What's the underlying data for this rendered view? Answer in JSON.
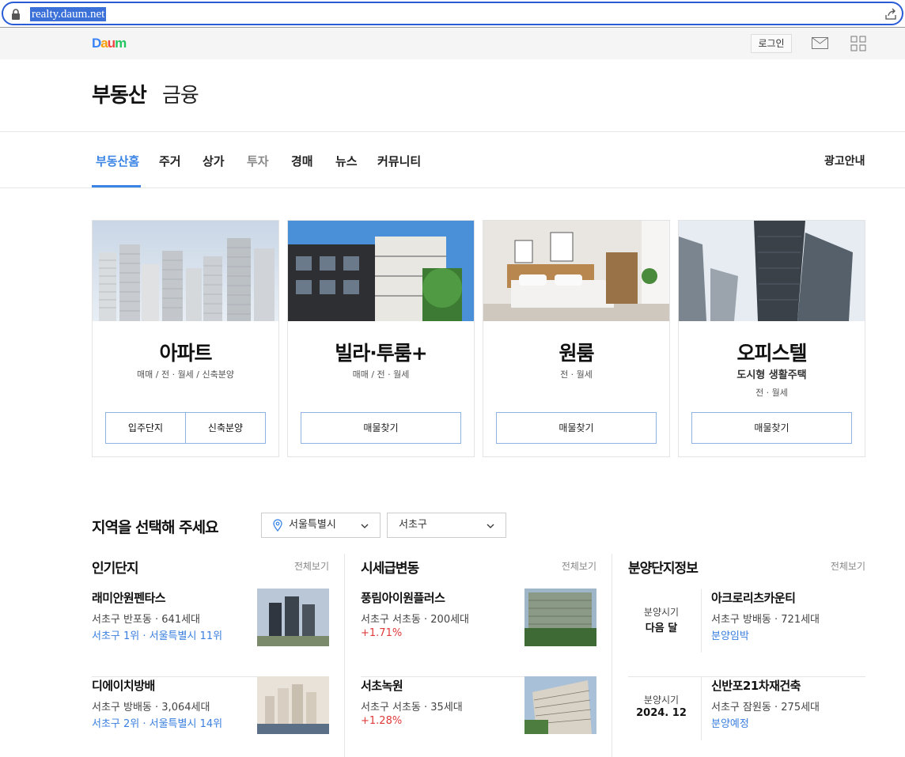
{
  "browser": {
    "url": "realty.daum.net"
  },
  "header": {
    "logo": "Daum",
    "login_label": "로그인"
  },
  "section": {
    "title": "부동산",
    "subtitle": "금융"
  },
  "nav": {
    "items": [
      {
        "label": "부동산홈"
      },
      {
        "label": "주거"
      },
      {
        "label": "상가"
      },
      {
        "label": "투자"
      },
      {
        "label": "경매"
      },
      {
        "label": "뉴스"
      },
      {
        "label": "커뮤니티"
      }
    ],
    "ad_label": "광고안내"
  },
  "cards": [
    {
      "title": "아파트",
      "sub": "매매 / 전 · 월세 / 신축분양",
      "btn1": "입주단지",
      "btn2": "신축분양"
    },
    {
      "title": "빌라·투룸+",
      "sub": "매매 / 전 · 월세",
      "btn": "매물찾기"
    },
    {
      "title": "원룸",
      "sub": "전 · 월세",
      "btn": "매물찾기"
    },
    {
      "title": "오피스텔",
      "sub_bold": "도시형 생활주택",
      "sub": "전 · 월세",
      "btn": "매물찾기"
    }
  ],
  "region": {
    "title": "지역을 선택해 주세요",
    "city": "서울특별시",
    "district": "서초구"
  },
  "popular": {
    "title": "인기단지",
    "more": "전체보기",
    "items": [
      {
        "name": "래미안원펜타스",
        "meta": "서초구 반포동 · 641세대",
        "rank": "서초구 1위 · 서울특별시 11위"
      },
      {
        "name": "디에이치방배",
        "meta": "서초구 방배동 · 3,064세대",
        "rank": "서초구 2위 · 서울특별시 14위"
      }
    ]
  },
  "price_change": {
    "title": "시세급변동",
    "more": "전체보기",
    "items": [
      {
        "name": "풍림아이원플러스",
        "meta": "서초구 서초동 · 200세대",
        "change": "+1.71%"
      },
      {
        "name": "서초녹원",
        "meta": "서초구 서초동 · 35세대",
        "change": "+1.28%"
      }
    ]
  },
  "sale_info": {
    "title": "분양단지정보",
    "more": "전체보기",
    "items": [
      {
        "when_label": "분양시기",
        "when": "다음 달",
        "name": "아크로리츠카운티",
        "meta": "서초구 방배동 · 721세대",
        "status": "분양임박"
      },
      {
        "when_label": "분양시기",
        "when": "2024. 12",
        "name": "신반포21차재건축",
        "meta": "서초구 잠원동 · 275세대",
        "status": "분양예정"
      }
    ]
  },
  "colors": {
    "accent": "#3a84e6",
    "link": "#3a7fe0",
    "up": "#e03a3a"
  }
}
